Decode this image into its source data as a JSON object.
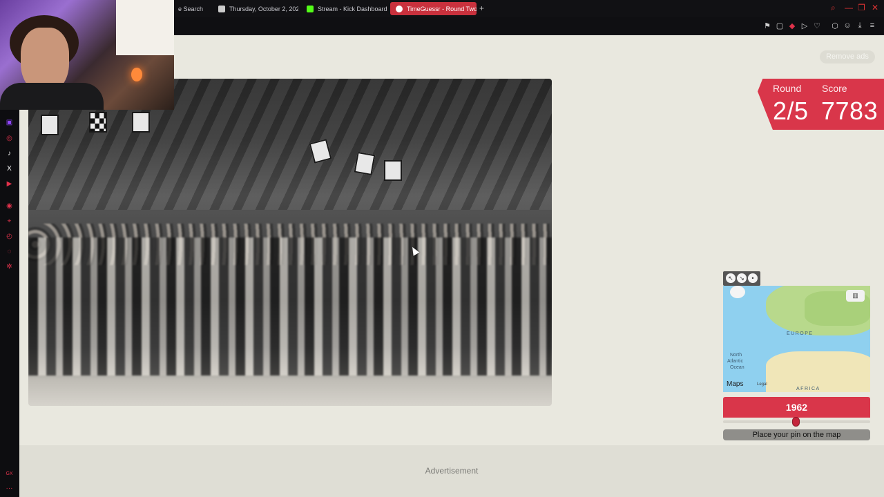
{
  "browser": {
    "tabs": [
      {
        "label": "e Search",
        "active": false,
        "favicon_color": "#888888"
      },
      {
        "label": "Thursday, October 2, 202",
        "active": false,
        "favicon_color": "#cccccc"
      },
      {
        "label": "Stream - Kick Dashboard",
        "active": false,
        "favicon_color": "#53fc18"
      },
      {
        "label": "TimeGuessr - Round Two",
        "active": true,
        "favicon_color": "#ffffff"
      }
    ],
    "new_tab_symbol": "+",
    "toolbar_icons": [
      "bookmark-icon",
      "screenshot-icon",
      "pocket-icon",
      "play-icon",
      "heart-icon",
      "extensions-icon",
      "account-icon",
      "download-icon",
      "menu-icon"
    ],
    "window_controls": [
      "search-icon",
      "minimize-icon",
      "restore-icon",
      "close-icon"
    ]
  },
  "sidebar": {
    "icons": [
      "twitch-icon",
      "instagram-icon",
      "tiktok-icon",
      "x-icon",
      "youtube-icon",
      "player-icon",
      "pin-icon",
      "history-icon",
      "chat-icon",
      "settings-icon",
      "gx-icon",
      "more-icon"
    ],
    "gx_label": "GX",
    "more_label": "···"
  },
  "game": {
    "remove_ads": "Remove ads",
    "round_label": "Round",
    "score_label": "Score",
    "round_value": "2/5",
    "score_value": "7783",
    "year": "1962",
    "year_fraction": 0.5,
    "place_pin": "Place your pin on the map",
    "map": {
      "europe": "EUROPE",
      "africa": "AFRICA",
      "ocean_line1": "North",
      "ocean_line2": "Atlantic",
      "ocean_line3": "Ocean",
      "maps_brand": "Maps",
      "legal": "Legal",
      "tools": [
        "expand-icon",
        "shrink-icon",
        "pin-icon"
      ],
      "toggle_icon": "map-style-icon"
    },
    "advertisement": "Advertisement"
  }
}
